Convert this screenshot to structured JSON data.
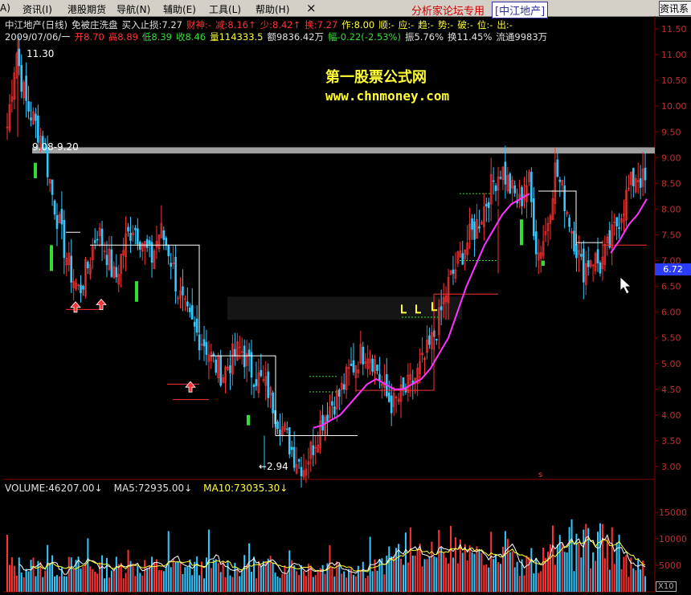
{
  "menu": {
    "left_marker": "A)",
    "items": [
      "资讯(I)",
      "港股期货",
      "导航(N)",
      "辅助(E)",
      "工具(L)",
      "帮助(H)"
    ],
    "close_glyph": "×",
    "forum": "分析家论坛专用",
    "stock_name": "[中江地产]",
    "info_button": "资讯系"
  },
  "header": {
    "row1": [
      {
        "text": "中江地产(日线)",
        "color": "w"
      },
      {
        "text": "免被庄洗盘",
        "color": "w"
      },
      {
        "text": "买入止损:7.27",
        "color": "w"
      },
      {
        "text": "财神:-",
        "color": "r"
      },
      {
        "text": "减:8.16↑",
        "color": "r"
      },
      {
        "text": "少:8.42↑",
        "color": "r"
      },
      {
        "text": "换:7.27",
        "color": "r"
      },
      {
        "text": "作:8.00",
        "color": "y"
      },
      {
        "text": "顺:-",
        "color": "y"
      },
      {
        "text": "应:-",
        "color": "y"
      },
      {
        "text": "趋:-",
        "color": "y"
      },
      {
        "text": "势:-",
        "color": "y"
      },
      {
        "text": "破:-",
        "color": "y"
      },
      {
        "text": "位:-",
        "color": "y"
      },
      {
        "text": "出:-",
        "color": "y"
      }
    ],
    "row2": [
      {
        "text": "2009/07/06/一",
        "color": "w"
      },
      {
        "text": "开8.70",
        "color": "r"
      },
      {
        "text": "高8.89",
        "color": "r"
      },
      {
        "text": "低8.39",
        "color": "g"
      },
      {
        "text": "收8.46",
        "color": "g"
      },
      {
        "text": "量114333.5",
        "color": "y"
      },
      {
        "text": "额9836.42万",
        "color": "w"
      },
      {
        "text": "幅-0.22(-2.53%)",
        "color": "g"
      },
      {
        "text": "振5.76%",
        "color": "w"
      },
      {
        "text": "换11.45%",
        "color": "w"
      },
      {
        "text": "流通9983万",
        "color": "w"
      }
    ]
  },
  "watermark": {
    "line1": "第一股票公式网",
    "line2": "www.chnmoney.com"
  },
  "chart_annotations": {
    "resistance_band": "9.08-9.20",
    "high_label": "11.30",
    "low_label": "←2.94",
    "current_price": "6.72",
    "volume_axis_scale": "X10",
    "marker_s": "s"
  },
  "volume_legend": [
    {
      "text": "VOLUME:46207.00↓",
      "color": "w"
    },
    {
      "text": "MA5:72935.00↓",
      "color": "w"
    },
    {
      "text": "MA10:73035.30↓",
      "color": "y"
    }
  ],
  "colors": {
    "bg": "#000000",
    "up": "#ff3333",
    "down": "#33c8ff",
    "signal_green": "#33dd33",
    "magenta_line": "#ff33ff",
    "grid": "#8b0000",
    "band": "#a0a0a0"
  },
  "chart_data": [
    {
      "type": "candlestick",
      "title": "中江地产(日线)",
      "y_ticks": [
        "11.50",
        "11.00",
        "10.50",
        "10.00",
        "9.50",
        "9.00",
        "8.50",
        "8.00",
        "7.50",
        "7.00",
        "6.50",
        "6.00",
        "5.50",
        "5.00",
        "4.50",
        "4.00",
        "3.50",
        "3.00"
      ],
      "ylim": [
        2.75,
        11.75
      ],
      "high": 11.3,
      "low": 2.94,
      "close_path": [
        9.6,
        11.1,
        10.1,
        9.7,
        9.3,
        8.3,
        7.5,
        6.8,
        6.4,
        6.9,
        7.6,
        7.2,
        6.6,
        7.3,
        7.7,
        7.4,
        7.0,
        7.6,
        7.2,
        6.4,
        5.9,
        5.6,
        5.4,
        5.0,
        4.8,
        5.1,
        5.3,
        4.9,
        4.7,
        4.5,
        4.0,
        3.6,
        3.2,
        3.0,
        3.4,
        3.9,
        4.2,
        4.4,
        4.8,
        5.1,
        5.3,
        5.0,
        4.4,
        4.2,
        4.4,
        4.6,
        4.9,
        5.3,
        5.8,
        6.5,
        6.9,
        7.3,
        7.6,
        8.0,
        8.5,
        8.8,
        8.4,
        8.1,
        8.6,
        7.1,
        7.6,
        8.8,
        8.2,
        7.5,
        6.8,
        7.1,
        6.9,
        7.3,
        7.8,
        8.3,
        8.7,
        8.5
      ],
      "ma_path": [
        null,
        null,
        null,
        null,
        null,
        null,
        null,
        null,
        null,
        null,
        null,
        null,
        null,
        null,
        null,
        null,
        null,
        null,
        null,
        null,
        null,
        null,
        null,
        null,
        null,
        null,
        null,
        null,
        null,
        null,
        null,
        null,
        null,
        null,
        3.75,
        3.8,
        3.9,
        4.0,
        4.2,
        4.4,
        4.6,
        4.7,
        4.6,
        4.5,
        4.5,
        4.6,
        4.7,
        4.9,
        5.2,
        5.5,
        6.0,
        6.5,
        6.9,
        7.3,
        7.6,
        7.9,
        8.1,
        8.2,
        8.3,
        null,
        null,
        null,
        null,
        null,
        null,
        null,
        null,
        7.15,
        7.4,
        7.7,
        7.9,
        8.2
      ],
      "ma_range": [
        34,
        58,
        67,
        71
      ]
    },
    {
      "type": "bar",
      "title": "VOLUME",
      "y_ticks": [
        "15000",
        "10000",
        "5000"
      ],
      "series": [
        {
          "name": "VOLUME",
          "last": 46207.0
        },
        {
          "name": "MA5",
          "last": 72935.0
        },
        {
          "name": "MA10",
          "last": 73035.3
        }
      ],
      "ylim": [
        0,
        18500
      ]
    }
  ]
}
